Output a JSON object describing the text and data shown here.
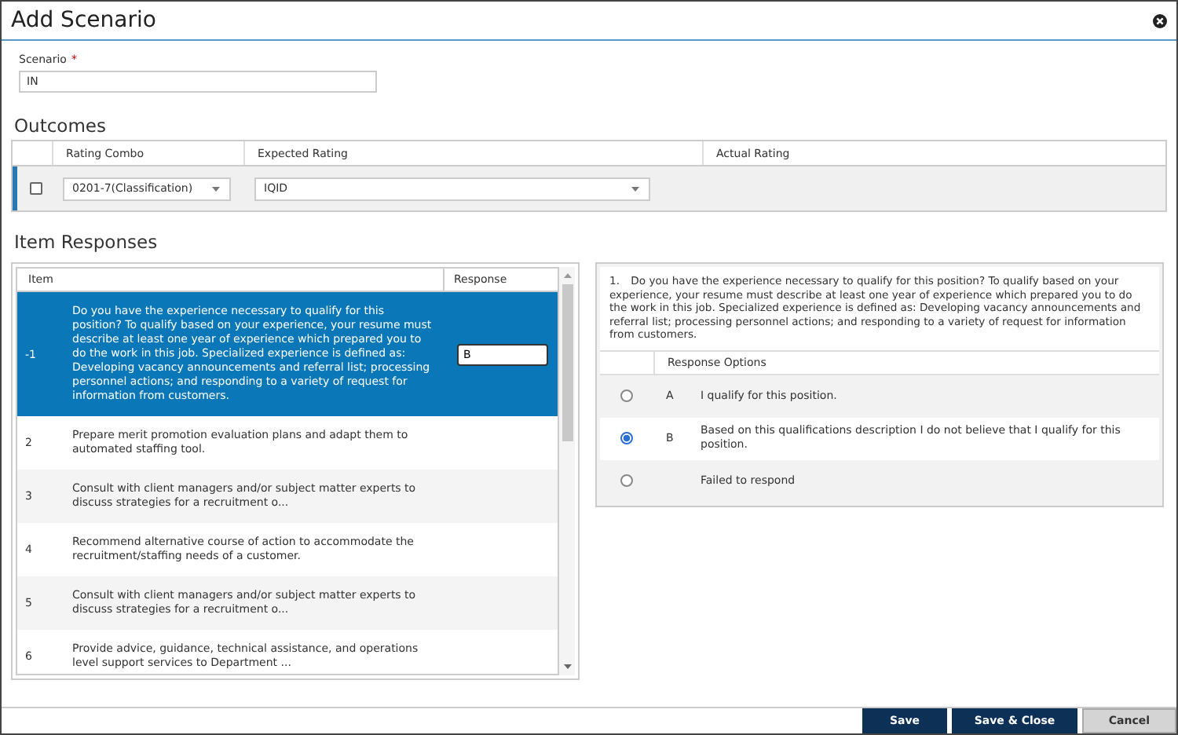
{
  "window": {
    "title": "Add Scenario"
  },
  "scenario": {
    "label": "Scenario",
    "required_mark": "*",
    "value": "IN"
  },
  "outcomes": {
    "heading": "Outcomes",
    "columns": [
      "Rating Combo",
      "Expected Rating",
      "Actual Rating"
    ],
    "rows": [
      {
        "checked": false,
        "rating_combo": "0201-7(Classification)",
        "expected_rating": "IQID"
      }
    ]
  },
  "item_responses": {
    "heading": "Item Responses",
    "columns": [
      "Item",
      "Response"
    ],
    "rows": [
      {
        "number": "-1",
        "text": "Do you have the experience necessary to qualify for this position? To qualify based on your experience, your resume must describe at least one year of experience which prepared you to do the work in this job. Specialized experience is defined as: Developing vacancy announcements and referral list; processing personnel actions; and responding to a variety of request for information from customers.",
        "response": "B",
        "selected": true
      },
      {
        "number": "2",
        "text": "Prepare merit promotion evaluation plans and adapt them to automated staffing tool.",
        "selected": false
      },
      {
        "number": "3",
        "text": "Consult with client managers and/or subject matter experts to discuss strategies for a recruitment o...",
        "selected": false
      },
      {
        "number": "4",
        "text": "Recommend alternative course of action to accommodate the recruitment/staffing needs of a customer.",
        "selected": false
      },
      {
        "number": "5",
        "text": "Consult with client managers and/or subject matter experts to discuss strategies for a recruitment o...",
        "selected": false
      },
      {
        "number": "6",
        "text": "Provide advice, guidance, technical assistance, and operations level support services to Department ...",
        "selected": false
      }
    ]
  },
  "detail": {
    "number": "1.",
    "question": "Do you have the experience necessary to qualify for this position? To qualify based on your experience, your resume must describe at least one year of experience which prepared you to do the work in this job. Specialized experience is defined as: Developing vacancy announcements and referral list; processing personnel actions; and responding to a variety of request for information from customers.",
    "options_header": "Response Options",
    "options": [
      {
        "letter": "A",
        "text": "I qualify for this position.",
        "selected": false
      },
      {
        "letter": "B",
        "text": "Based on this qualifications description I do not believe that I qualify for this position.",
        "selected": true
      },
      {
        "text": "Failed to respond",
        "selected": false
      }
    ]
  },
  "buttons": [
    {
      "label": "Save",
      "kind": "primary"
    },
    {
      "label": "Save & Close",
      "kind": "primary"
    },
    {
      "label": "Cancel",
      "kind": "secondary"
    }
  ]
}
